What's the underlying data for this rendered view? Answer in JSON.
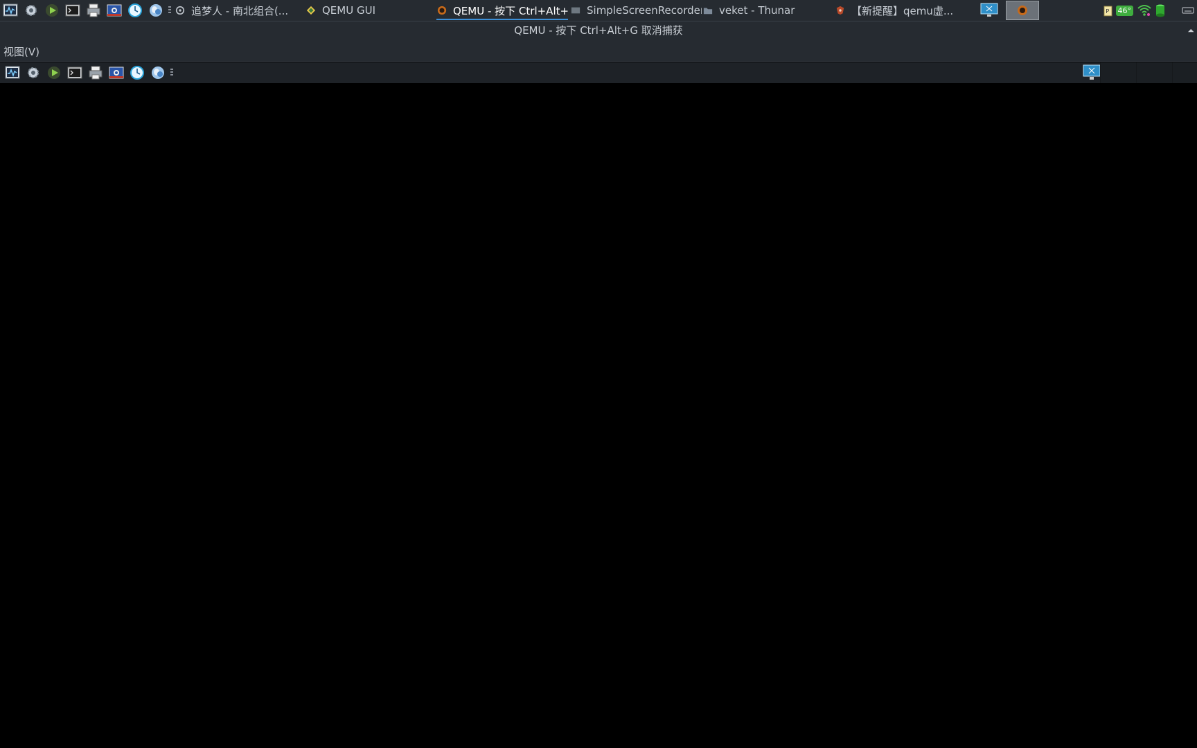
{
  "taskbar": {
    "launchers": [
      {
        "icon": "system-monitor-icon"
      },
      {
        "icon": "settings-gear-icon"
      },
      {
        "icon": "play-icon"
      },
      {
        "icon": "terminal-icon"
      },
      {
        "icon": "printer-icon"
      },
      {
        "icon": "screenshot-icon"
      },
      {
        "icon": "clock-icon"
      },
      {
        "icon": "browser-globe-icon"
      }
    ],
    "tasks": [
      {
        "label": "追梦人 - 南北组合(...",
        "icon": "music-player-icon"
      },
      {
        "label": "QEMU GUI",
        "icon": "qemu-gui-icon"
      },
      {
        "label": "QEMU - 按下 Ctrl+Alt+...",
        "icon": "qemu-icon",
        "active": true
      },
      {
        "label": "SimpleScreenRecorder",
        "icon": "recorder-icon"
      },
      {
        "label": "veket - Thunar",
        "icon": "folder-icon"
      },
      {
        "label": "【新提醒】qemu虚...",
        "icon": "browser-icon"
      }
    ],
    "tray": {
      "temperature": "46°",
      "icons": [
        "clipboard-icon",
        "temperature-icon",
        "wifi-icon",
        "battery-icon",
        "keyboard-icon"
      ]
    }
  },
  "window": {
    "title": "QEMU - 按下 Ctrl+Alt+G 取消捕获",
    "menu": {
      "view": "视图(V)"
    }
  },
  "colors": {
    "panel": "#262b31",
    "accent": "#3d8fd6",
    "viewport": "#000000"
  }
}
